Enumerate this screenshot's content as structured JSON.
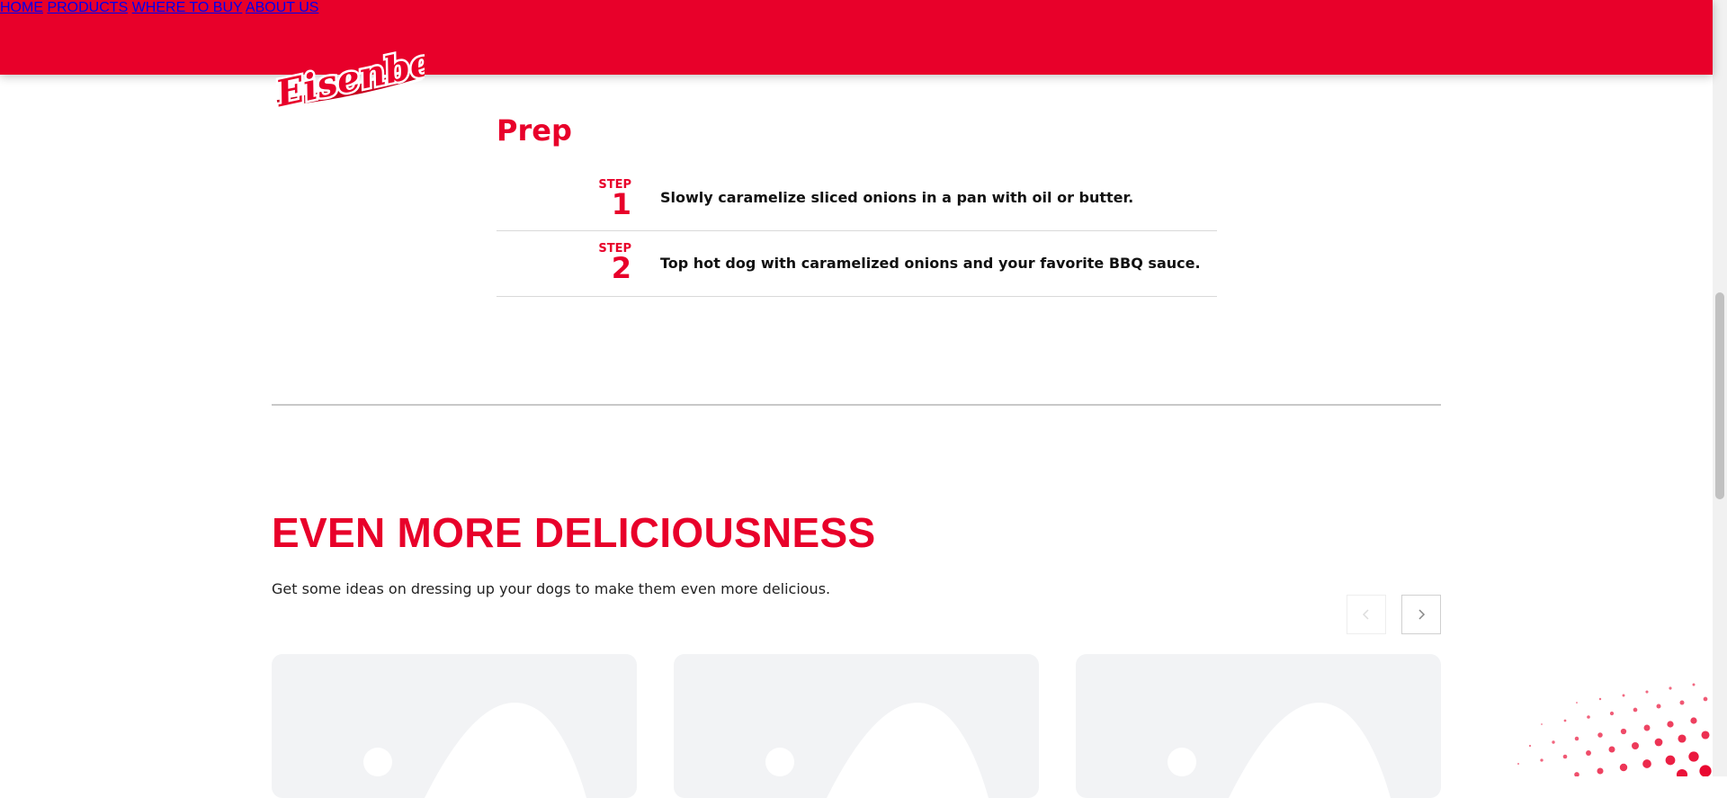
{
  "nav": {
    "items": [
      {
        "label": "HOME"
      },
      {
        "label": "PRODUCTS"
      },
      {
        "label": "WHERE TO BUY"
      },
      {
        "label": "ABOUT US"
      }
    ]
  },
  "logo": {
    "text": "Eisenberg"
  },
  "prep": {
    "title": "Prep",
    "steps": [
      {
        "label": "STEP",
        "number": "1",
        "text": "Slowly caramelize sliced onions in a pan with oil or butter."
      },
      {
        "label": "STEP",
        "number": "2",
        "text": "Top hot dog with caramelized onions and your favorite BBQ sauce."
      }
    ]
  },
  "more": {
    "title": "EVEN MORE DELICIOUSNESS",
    "description": "Get some ideas on dressing up your dogs to make them even more delicious."
  },
  "carousel": {
    "prev_icon": "chevron-left-icon",
    "next_icon": "chevron-right-icon"
  },
  "colors": {
    "brand_red": "#e8002a",
    "card_bg": "#f2f3f5"
  }
}
